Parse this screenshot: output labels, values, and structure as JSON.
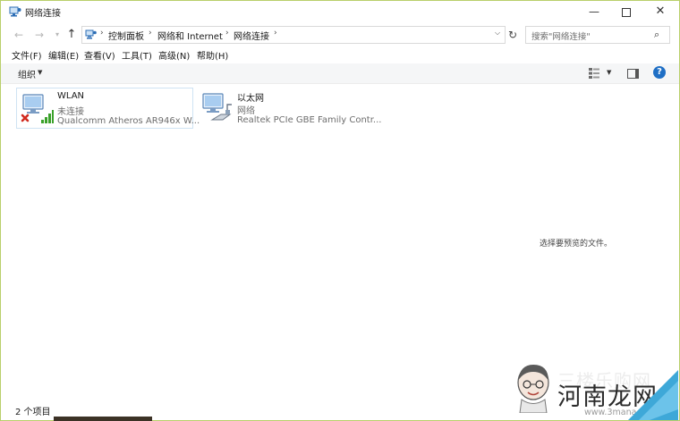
{
  "window": {
    "title": "网络连接",
    "buttons": {
      "minimize": "—",
      "close": "✕"
    }
  },
  "address": {
    "crumbs": [
      "控制面板",
      "网络和 Internet",
      "网络连接"
    ],
    "search_placeholder": "搜索\"网络连接\""
  },
  "menu": [
    "文件(F)",
    "编辑(E)",
    "查看(V)",
    "工具(T)",
    "高级(N)",
    "帮助(H)"
  ],
  "commandbar": {
    "organize": "组织",
    "help": "?"
  },
  "connections": [
    {
      "name": "WLAN",
      "status": "未连接",
      "device": "Qualcomm Atheros AR946x W...",
      "icon": "wireless-adapter-disconnected-icon"
    },
    {
      "name": "以太网",
      "status": "网络",
      "device": "Realtek PCIe GBE Family Contr...",
      "icon": "ethernet-adapter-icon"
    }
  ],
  "preview": {
    "text": "选择要预览的文件。"
  },
  "statusbar": {
    "count": "2 个项目"
  },
  "watermark": {
    "brand": "河南龙网",
    "url": "www.3mana.com",
    "faded": "三楼乐购网"
  },
  "colors": {
    "accent": "#1f6fc5",
    "window_border": "#b9cf6b",
    "selection_border": "#cfe3f3",
    "signal_green": "#3aa12a",
    "error_red": "#d12a1f"
  }
}
